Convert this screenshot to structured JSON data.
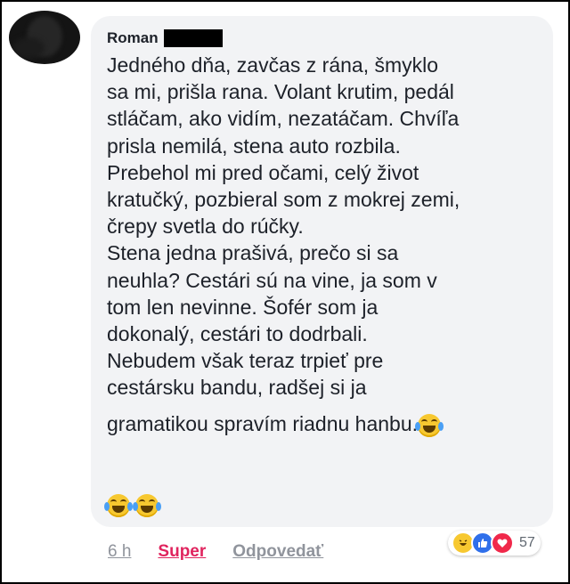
{
  "comment": {
    "author": "Roman",
    "lines": [
      "Jedného dňa, zavčas z rána, šmyklo",
      "sa mi, prišla rana. Volant krutim, pedál",
      "stláčam, ako vidím, nezatáčam. Chvíľa",
      "prisla nemilá, stena auto rozbila.",
      "Prebehol mi pred očami, celý život",
      "kratučký, pozbieral som z mokrej zemi,",
      "črepy svetla do rúčky.",
      "Stena jedna prašivá, prečo si sa",
      "neuhla? Cestári sú na vine, ja som v",
      "tom len nevinne. Šofér som ja",
      "dokonalý, cestári to dodrbali.",
      "Nebudem však teraz trpieť pre",
      "cestársku bandu, radšej si ja",
      "gramatikou spravím riadnu hanbu."
    ],
    "emojis": [
      "face-with-tears-of-joy",
      "face-with-tears-of-joy"
    ]
  },
  "actions": {
    "time": "6 h",
    "like_label": "Super",
    "reply_label": "Odpovedať"
  },
  "reactions": {
    "types": [
      "haha",
      "like",
      "love"
    ],
    "count": "57"
  },
  "colors": {
    "bubble": "#f2f3f5",
    "like_active": "#e0245e",
    "meta": "#90949c"
  }
}
